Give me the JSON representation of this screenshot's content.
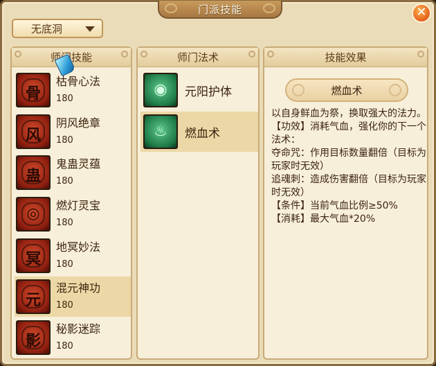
{
  "window": {
    "title": "门派技能"
  },
  "school_select": {
    "value": "无底洞"
  },
  "panels": {
    "left_header": "师门技能",
    "mid_header": "师门法术",
    "right_header": "技能效果"
  },
  "skills": [
    {
      "name": "枯骨心法",
      "level": "180",
      "icon": "skull-skill-icon",
      "glyph": "骨"
    },
    {
      "name": "阴风绝章",
      "level": "180",
      "icon": "wind-skill-icon",
      "glyph": "风"
    },
    {
      "name": "鬼蛊灵蕴",
      "level": "180",
      "icon": "scorpion-skill-icon",
      "glyph": "蛊"
    },
    {
      "name": "燃灯灵宝",
      "level": "180",
      "icon": "lantern-skill-icon",
      "glyph": "◎"
    },
    {
      "name": "地冥妙法",
      "level": "180",
      "icon": "tree-skill-icon",
      "glyph": "冥"
    },
    {
      "name": "混元神功",
      "level": "180",
      "icon": "swirl-skill-icon",
      "glyph": "元"
    },
    {
      "name": "秘影迷踪",
      "level": "180",
      "icon": "shadow-skill-icon",
      "glyph": "影"
    }
  ],
  "selected_skill_index": 5,
  "techniques": [
    {
      "name": "元阳护体",
      "icon": "spiral-spell-icon",
      "glyph": "◉"
    },
    {
      "name": "燃血术",
      "icon": "flame-spell-icon",
      "glyph": "♨"
    }
  ],
  "selected_technique_index": 1,
  "effect": {
    "title": "燃血术",
    "description": "以自身鲜血为祭，换取强大的法力。\n【功效】消耗气血，强化你的下一个法术：\n夺命咒：作用目标数量翻倍（目标为玩家时无效）\n追魂刺：造成伤害翻倍（目标为玩家时无效）\n【条件】当前气血比例≥50%\n【消耗】最大气血*20%"
  },
  "colors": {
    "background": "#eadcb8",
    "panel": "#f7efd9",
    "selected_row": "#ecd8a6",
    "text": "#3c2410",
    "close_button": "#e2611a"
  }
}
